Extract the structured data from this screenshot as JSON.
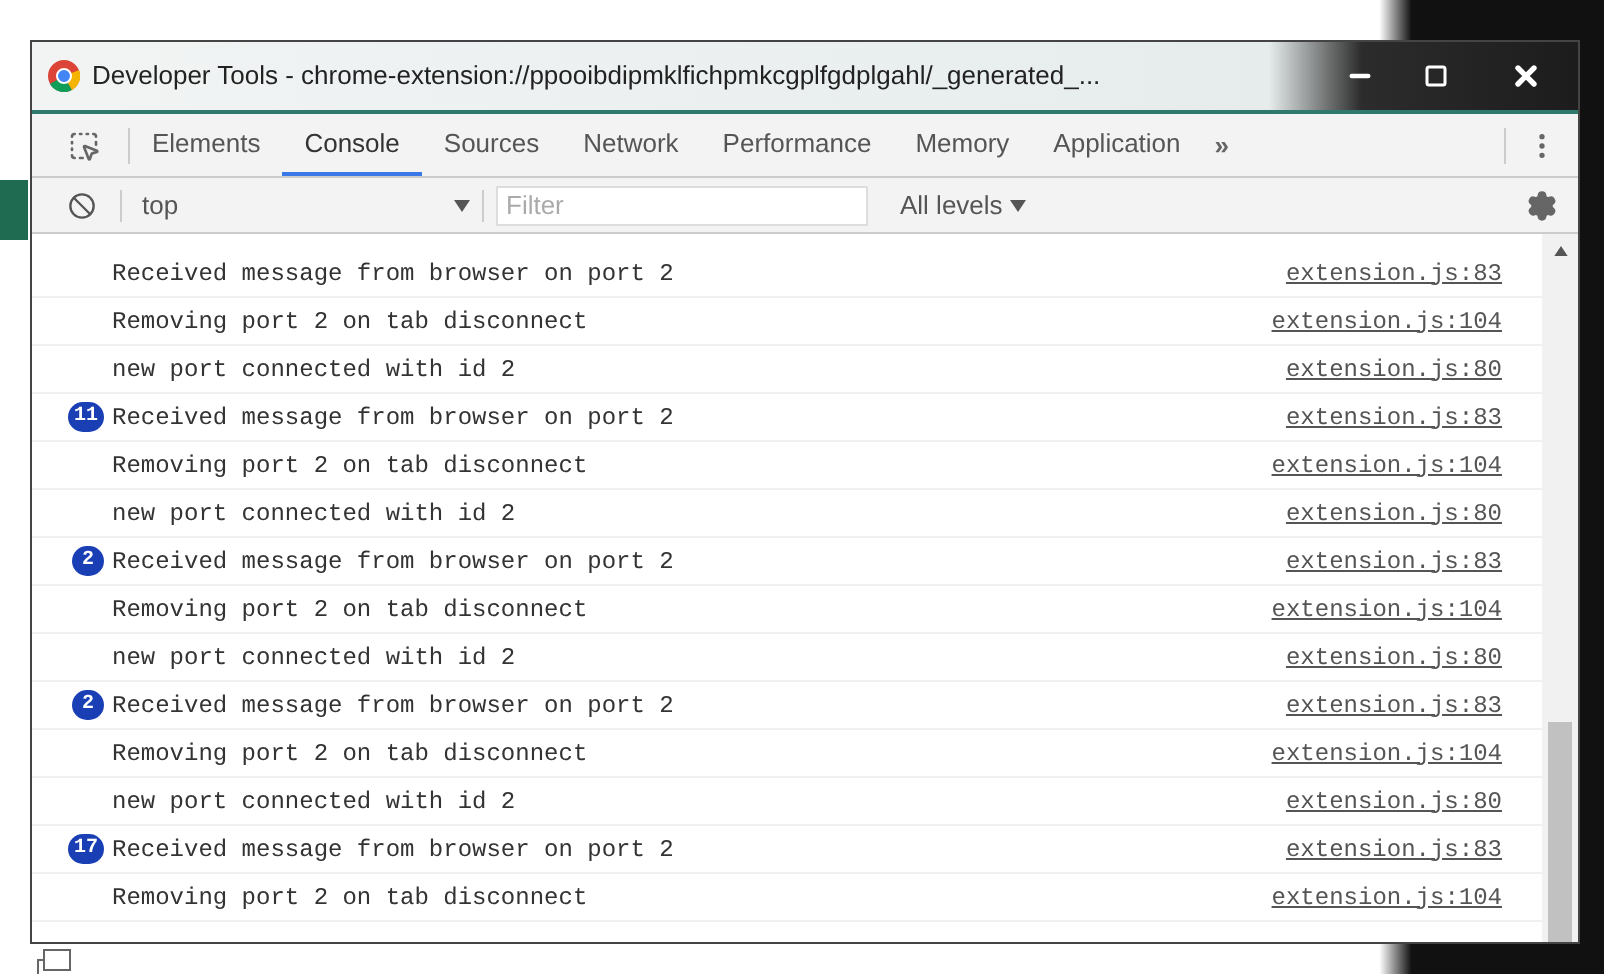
{
  "window": {
    "title": "Developer Tools - chrome-extension://ppooibdipmklfichpmkcgplfgdplgahl/_generated_..."
  },
  "tabs": [
    {
      "label": "Elements",
      "selected": false
    },
    {
      "label": "Console",
      "selected": true
    },
    {
      "label": "Sources",
      "selected": false
    },
    {
      "label": "Network",
      "selected": false
    },
    {
      "label": "Performance",
      "selected": false
    },
    {
      "label": "Memory",
      "selected": false
    },
    {
      "label": "Application",
      "selected": false
    }
  ],
  "more_tabs": "»",
  "toolbar": {
    "context": "top",
    "filter": {
      "placeholder": "Filter"
    },
    "levels": "All levels"
  },
  "messages": [
    {
      "text": "Received message from browser on port 2",
      "source": "extension.js:83"
    },
    {
      "text": "Removing port 2 on tab disconnect",
      "source": "extension.js:104"
    },
    {
      "text": "new port connected with id 2",
      "source": "extension.js:80"
    },
    {
      "count": "11",
      "text": "Received message from browser on port 2",
      "source": "extension.js:83"
    },
    {
      "text": "Removing port 2 on tab disconnect",
      "source": "extension.js:104"
    },
    {
      "text": "new port connected with id 2",
      "source": "extension.js:80"
    },
    {
      "count": "2",
      "text": "Received message from browser on port 2",
      "source": "extension.js:83"
    },
    {
      "text": "Removing port 2 on tab disconnect",
      "source": "extension.js:104"
    },
    {
      "text": "new port connected with id 2",
      "source": "extension.js:80"
    },
    {
      "count": "2",
      "text": "Received message from browser on port 2",
      "source": "extension.js:83"
    },
    {
      "text": "Removing port 2 on tab disconnect",
      "source": "extension.js:104"
    },
    {
      "text": "new port connected with id 2",
      "source": "extension.js:80"
    },
    {
      "count": "17",
      "text": "Received message from browser on port 2",
      "source": "extension.js:83"
    },
    {
      "text": "Removing port 2 on tab disconnect",
      "source": "extension.js:104"
    }
  ]
}
